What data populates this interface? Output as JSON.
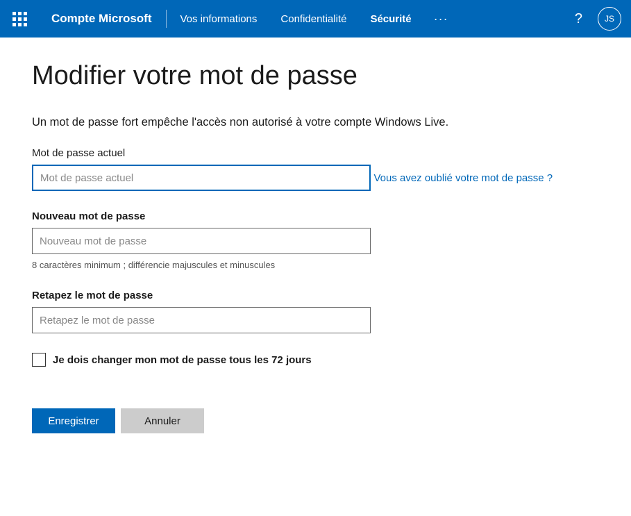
{
  "header": {
    "brand": "Compte Microsoft",
    "nav": {
      "info": "Vos informations",
      "privacy": "Confidentialité",
      "security": "Sécurité"
    },
    "more": "···",
    "help": "?",
    "avatar_initials": "JS"
  },
  "page": {
    "title": "Modifier votre mot de passe",
    "subtitle": "Un mot de passe fort empêche l'accès non autorisé à votre compte Windows Live."
  },
  "form": {
    "current": {
      "label": "Mot de passe actuel",
      "placeholder": "Mot de passe actuel",
      "forgot": "Vous avez oublié votre mot de passe ?"
    },
    "newpw": {
      "label": "Nouveau mot de passe",
      "placeholder": "Nouveau mot de passe",
      "hint": "8 caractères minimum ; différencie majuscules et minuscules"
    },
    "retype": {
      "label": "Retapez le mot de passe",
      "placeholder": "Retapez le mot de passe"
    },
    "checkbox_label": "Je dois changer mon mot de passe tous les 72 jours",
    "save": "Enregistrer",
    "cancel": "Annuler"
  }
}
